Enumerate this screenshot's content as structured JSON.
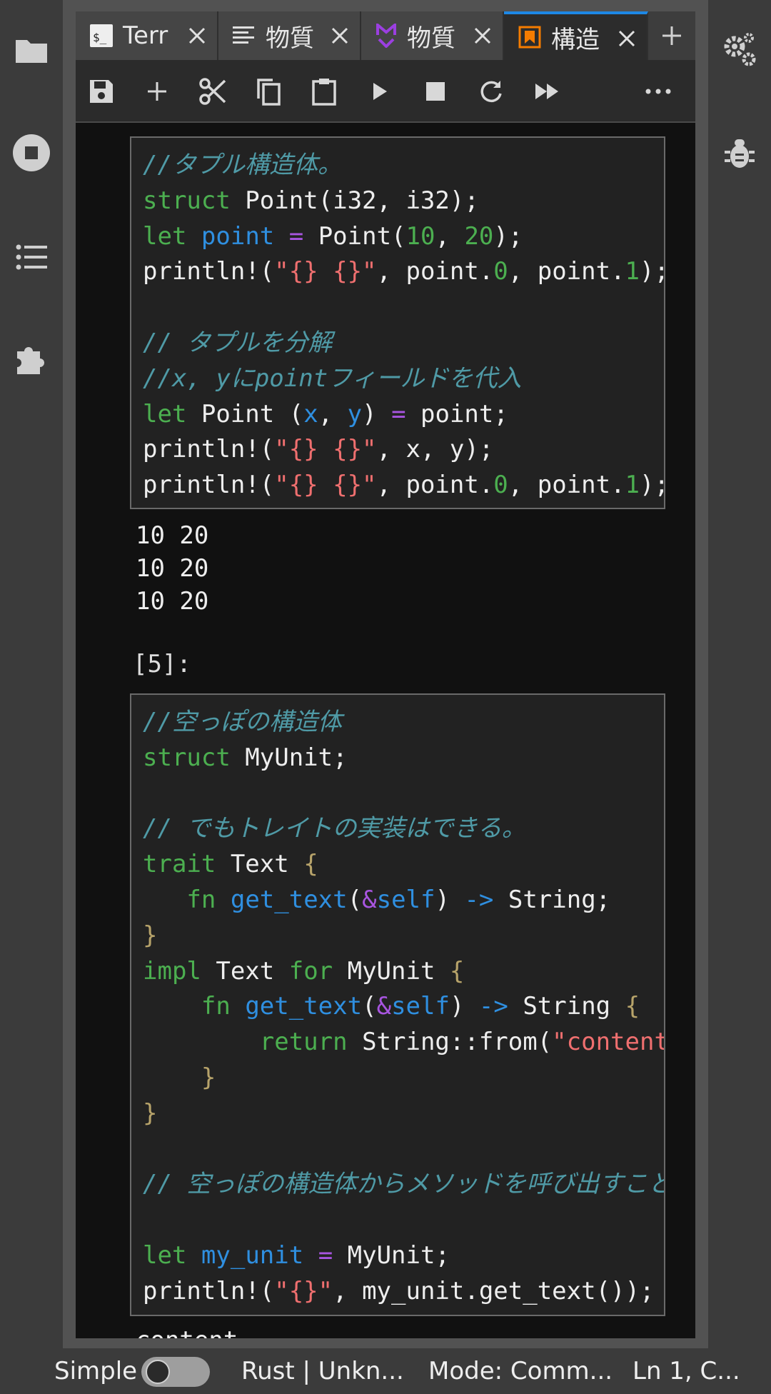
{
  "tabs": [
    {
      "label": "Terr",
      "icon": "terminal-icon"
    },
    {
      "label": "物質",
      "icon": "text-file-icon"
    },
    {
      "label": "物質",
      "icon": "markdown-icon"
    },
    {
      "label": "構造",
      "icon": "notebook-icon"
    }
  ],
  "cell1": {
    "lines": [
      [
        {
          "t": "//タプル構造体。",
          "c": "com"
        }
      ],
      [
        {
          "t": "struct",
          "c": "kw"
        },
        {
          "t": " Point(i32, i32);"
        }
      ],
      [
        {
          "t": "let",
          "c": "kw"
        },
        {
          "t": " "
        },
        {
          "t": "point",
          "c": "var"
        },
        {
          "t": " "
        },
        {
          "t": "=",
          "c": "op"
        },
        {
          "t": " Point("
        },
        {
          "t": "10",
          "c": "num"
        },
        {
          "t": ", "
        },
        {
          "t": "20",
          "c": "num"
        },
        {
          "t": ");"
        }
      ],
      [
        {
          "t": "println!("
        },
        {
          "t": "\"{} {}\"",
          "c": "str"
        },
        {
          "t": ", point."
        },
        {
          "t": "0",
          "c": "num"
        },
        {
          "t": ", point."
        },
        {
          "t": "1",
          "c": "num"
        },
        {
          "t": ");"
        }
      ],
      [
        {
          "t": ""
        }
      ],
      [
        {
          "t": "// タプルを分解",
          "c": "com"
        }
      ],
      [
        {
          "t": "//x, yにpointフィールドを代入",
          "c": "com"
        }
      ],
      [
        {
          "t": "let",
          "c": "kw"
        },
        {
          "t": " Point ("
        },
        {
          "t": "x",
          "c": "var"
        },
        {
          "t": ", "
        },
        {
          "t": "y",
          "c": "var"
        },
        {
          "t": ") "
        },
        {
          "t": "=",
          "c": "op"
        },
        {
          "t": " point;"
        }
      ],
      [
        {
          "t": "println!("
        },
        {
          "t": "\"{} {}\"",
          "c": "str"
        },
        {
          "t": ", x, y);"
        }
      ],
      [
        {
          "t": "println!("
        },
        {
          "t": "\"{} {}\"",
          "c": "str"
        },
        {
          "t": ", point."
        },
        {
          "t": "0",
          "c": "num"
        },
        {
          "t": ", point."
        },
        {
          "t": "1",
          "c": "num"
        },
        {
          "t": ");"
        }
      ]
    ]
  },
  "output1": "10 20\n10 20\n10 20",
  "prompt2": "[5]:",
  "cell2": {
    "lines": [
      [
        {
          "t": "//空っぽの構造体",
          "c": "com"
        }
      ],
      [
        {
          "t": "struct",
          "c": "kw"
        },
        {
          "t": " MyUnit;"
        }
      ],
      [
        {
          "t": ""
        }
      ],
      [
        {
          "t": "// でもトレイトの実装はできる。",
          "c": "com"
        }
      ],
      [
        {
          "t": "trait",
          "c": "kw"
        },
        {
          "t": " Text "
        },
        {
          "t": "{",
          "c": "brk"
        }
      ],
      [
        {
          "t": "   "
        },
        {
          "t": "fn",
          "c": "kw"
        },
        {
          "t": " "
        },
        {
          "t": "get_text",
          "c": "fn"
        },
        {
          "t": "("
        },
        {
          "t": "&",
          "c": "op"
        },
        {
          "t": "self",
          "c": "var"
        },
        {
          "t": ") "
        },
        {
          "t": "->",
          "c": "var"
        },
        {
          "t": " String;"
        }
      ],
      [
        {
          "t": "}",
          "c": "brk"
        }
      ],
      [
        {
          "t": "impl",
          "c": "kw"
        },
        {
          "t": " Text "
        },
        {
          "t": "for",
          "c": "kw"
        },
        {
          "t": " MyUnit "
        },
        {
          "t": "{",
          "c": "brk"
        }
      ],
      [
        {
          "t": "    "
        },
        {
          "t": "fn",
          "c": "kw"
        },
        {
          "t": " "
        },
        {
          "t": "get_text",
          "c": "fn"
        },
        {
          "t": "("
        },
        {
          "t": "&",
          "c": "op"
        },
        {
          "t": "self",
          "c": "var"
        },
        {
          "t": ") "
        },
        {
          "t": "->",
          "c": "var"
        },
        {
          "t": " String "
        },
        {
          "t": "{",
          "c": "brk"
        }
      ],
      [
        {
          "t": "        "
        },
        {
          "t": "return",
          "c": "kw"
        },
        {
          "t": " String::from("
        },
        {
          "t": "\"content\"",
          "c": "str"
        },
        {
          "t": ")"
        }
      ],
      [
        {
          "t": "    "
        },
        {
          "t": "}",
          "c": "brk"
        }
      ],
      [
        {
          "t": "}",
          "c": "brk"
        }
      ],
      [
        {
          "t": ""
        }
      ],
      [
        {
          "t": "// 空っぽの構造体からメソッドを呼び出すこと",
          "c": "com"
        }
      ],
      [
        {
          "t": ""
        }
      ],
      [
        {
          "t": "let",
          "c": "kw"
        },
        {
          "t": " "
        },
        {
          "t": "my_unit",
          "c": "var"
        },
        {
          "t": " "
        },
        {
          "t": "=",
          "c": "op"
        },
        {
          "t": " MyUnit;"
        }
      ],
      [
        {
          "t": "println!("
        },
        {
          "t": "\"{}\"",
          "c": "str"
        },
        {
          "t": ", my_unit.get_text());"
        }
      ]
    ]
  },
  "output2": "content",
  "status": {
    "mode_label": "Simple",
    "simple_enabled": false,
    "kernel": "Rust | Unkn...",
    "mode": "Mode: Comm...",
    "position": "Ln 1, C..."
  },
  "colors": {
    "accent": "#1e88e5",
    "keyword": "#4caf50",
    "comment": "#4f9aa6",
    "string": "#ef6f6f",
    "variable": "#2f8fe0",
    "operator": "#a855e0"
  }
}
